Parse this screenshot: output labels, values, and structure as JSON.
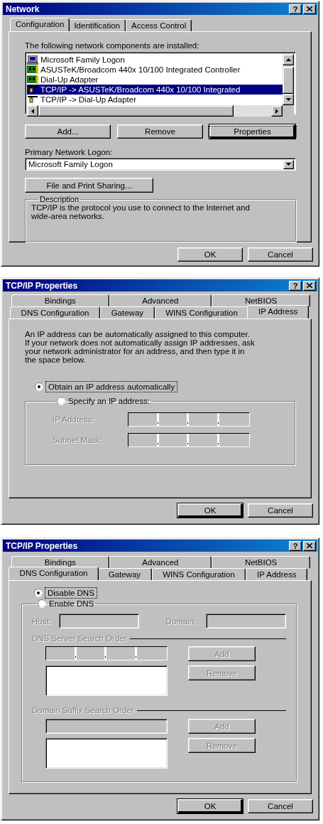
{
  "dialogs": [
    {
      "kind": "network",
      "title": "Network",
      "help": "?",
      "tab_rows": [
        [
          {
            "label": "Configuration",
            "selected": true
          },
          {
            "label": "Identification",
            "selected": false
          },
          {
            "label": "Access Control",
            "selected": false
          }
        ]
      ],
      "components_label": "The following network components are installed:",
      "components": [
        {
          "kind": "client",
          "label": "Microsoft Family Logon",
          "selected": false
        },
        {
          "kind": "adapter",
          "label": "ASUSTeK/Broadcom 440x 10/100 Integrated Controller",
          "selected": false
        },
        {
          "kind": "adapter",
          "label": "Dial-Up Adapter",
          "selected": false
        },
        {
          "kind": "protocol",
          "label": "TCP/IP -> ASUSTeK/Broadcom 440x 10/100 Integrated",
          "selected": true
        },
        {
          "kind": "protocol",
          "label": "TCP/IP -> Dial-Up Adapter",
          "selected": false
        }
      ],
      "component_buttons": [
        {
          "label": "Add...",
          "default": false,
          "focused": false
        },
        {
          "label": "Remove",
          "default": false,
          "focused": false
        },
        {
          "label": "Properties",
          "default": true,
          "focused": true
        }
      ],
      "logon_label": "Primary Network Logon:",
      "logon_value": "Microsoft Family Logon",
      "sharing_button": "File and Print Sharing...",
      "description": {
        "title": "Description",
        "lines": [
          "TCP/IP is the protocol you use to connect to the Internet and",
          "wide-area networks."
        ]
      },
      "buttons": [
        {
          "label": "OK",
          "default": false
        },
        {
          "label": "Cancel",
          "default": false
        }
      ]
    },
    {
      "kind": "ip_address",
      "title": "TCP/IP Properties",
      "help": "?",
      "tab_rows": [
        [
          {
            "label": "Bindings",
            "selected": false
          },
          {
            "label": "Advanced",
            "selected": false
          },
          {
            "label": "NetBIOS",
            "selected": false
          }
        ],
        [
          {
            "label": "DNS Configuration",
            "selected": false
          },
          {
            "label": "Gateway",
            "selected": false
          },
          {
            "label": "WINS Configuration",
            "selected": false
          },
          {
            "label": "IP Address",
            "selected": true
          }
        ]
      ],
      "intro_lines": [
        "An IP address can be automatically assigned to this computer.",
        "If your network does not automatically assign IP addresses, ask",
        "your network administrator for an address, and then type it in",
        "the space below."
      ],
      "options": [
        {
          "label": "Obtain an IP address automatically",
          "checked": true,
          "focused": true
        },
        {
          "label": "Specify an IP address:",
          "checked": false,
          "focused": false
        }
      ],
      "fields": [
        {
          "label": "IP Address:",
          "disabled": true
        },
        {
          "label": "Subnet Mask:",
          "disabled": true
        }
      ],
      "buttons": [
        {
          "label": "OK",
          "default": true
        },
        {
          "label": "Cancel",
          "default": false
        }
      ]
    },
    {
      "kind": "dns",
      "title": "TCP/IP Properties",
      "help": "?",
      "tab_rows": [
        [
          {
            "label": "Bindings",
            "selected": false
          },
          {
            "label": "Advanced",
            "selected": false
          },
          {
            "label": "NetBIOS",
            "selected": false
          }
        ],
        [
          {
            "label": "DNS Configuration",
            "selected": true
          },
          {
            "label": "Gateway",
            "selected": false
          },
          {
            "label": "WINS Configuration",
            "selected": false
          },
          {
            "label": "IP Address",
            "selected": false
          }
        ]
      ],
      "options": [
        {
          "label": "Disable DNS",
          "checked": true,
          "focused": true
        },
        {
          "label": "Enable DNS",
          "checked": false,
          "focused": false
        }
      ],
      "host": {
        "label": "Host:",
        "disabled": true
      },
      "domain": {
        "label": "Domain:",
        "disabled": true
      },
      "sections": [
        {
          "kind": "ip",
          "title": "DNS Server Search Order",
          "disabled": true,
          "buttons": [
            {
              "label": "Add",
              "disabled": true
            },
            {
              "label": "Remove",
              "disabled": true
            }
          ]
        },
        {
          "kind": "text",
          "title": "Domain Suffix Search Order",
          "disabled": true,
          "buttons": [
            {
              "label": "Add",
              "disabled": true
            },
            {
              "label": "Remove",
              "disabled": true
            }
          ]
        }
      ],
      "buttons": [
        {
          "label": "OK",
          "default": true
        },
        {
          "label": "Cancel",
          "default": false
        }
      ]
    }
  ]
}
